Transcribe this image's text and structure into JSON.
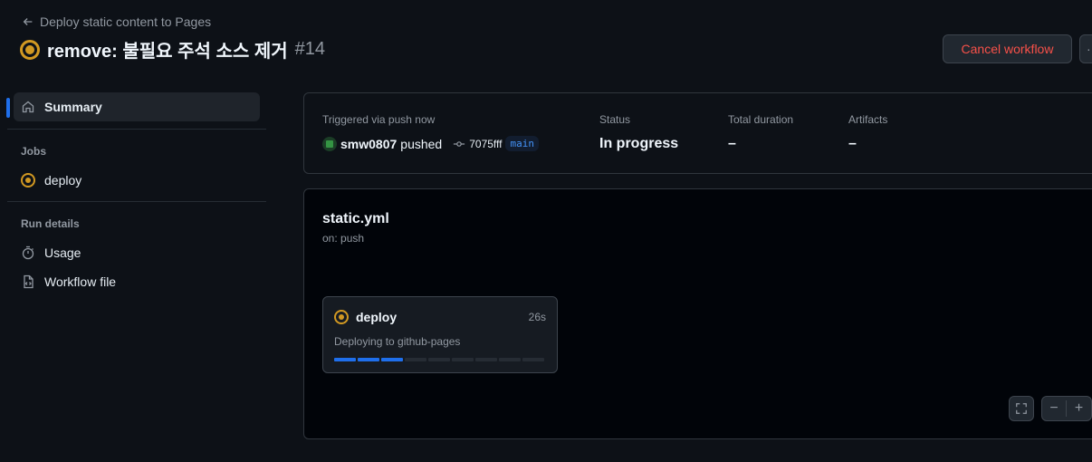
{
  "header": {
    "back_label": "Deploy static content to Pages",
    "title": "remove: 불필요 주석 소스 제거",
    "run_number": "#14",
    "cancel_label": "Cancel workflow",
    "more_label": "···"
  },
  "sidebar": {
    "summary_label": "Summary",
    "jobs_header": "Jobs",
    "job_label": "deploy",
    "run_details_header": "Run details",
    "usage_label": "Usage",
    "workflow_file_label": "Workflow file"
  },
  "summary": {
    "trigger_label": "Triggered via push now",
    "user": "smw0807",
    "action": "pushed",
    "commit": "7075fff",
    "branch": "main",
    "status_label": "Status",
    "status_value": "In progress",
    "duration_label": "Total duration",
    "duration_value": "–",
    "artifacts_label": "Artifacts",
    "artifacts_value": "–"
  },
  "graph": {
    "workflow_name": "static.yml",
    "trigger": "on: push",
    "job": {
      "name": "deploy",
      "duration": "26s",
      "step": "Deploying to github-pages",
      "progress_filled": 3,
      "progress_total": 9
    }
  },
  "colors": {
    "accent": "#1f6feb",
    "in_progress": "#d29922",
    "danger": "#f85149"
  }
}
